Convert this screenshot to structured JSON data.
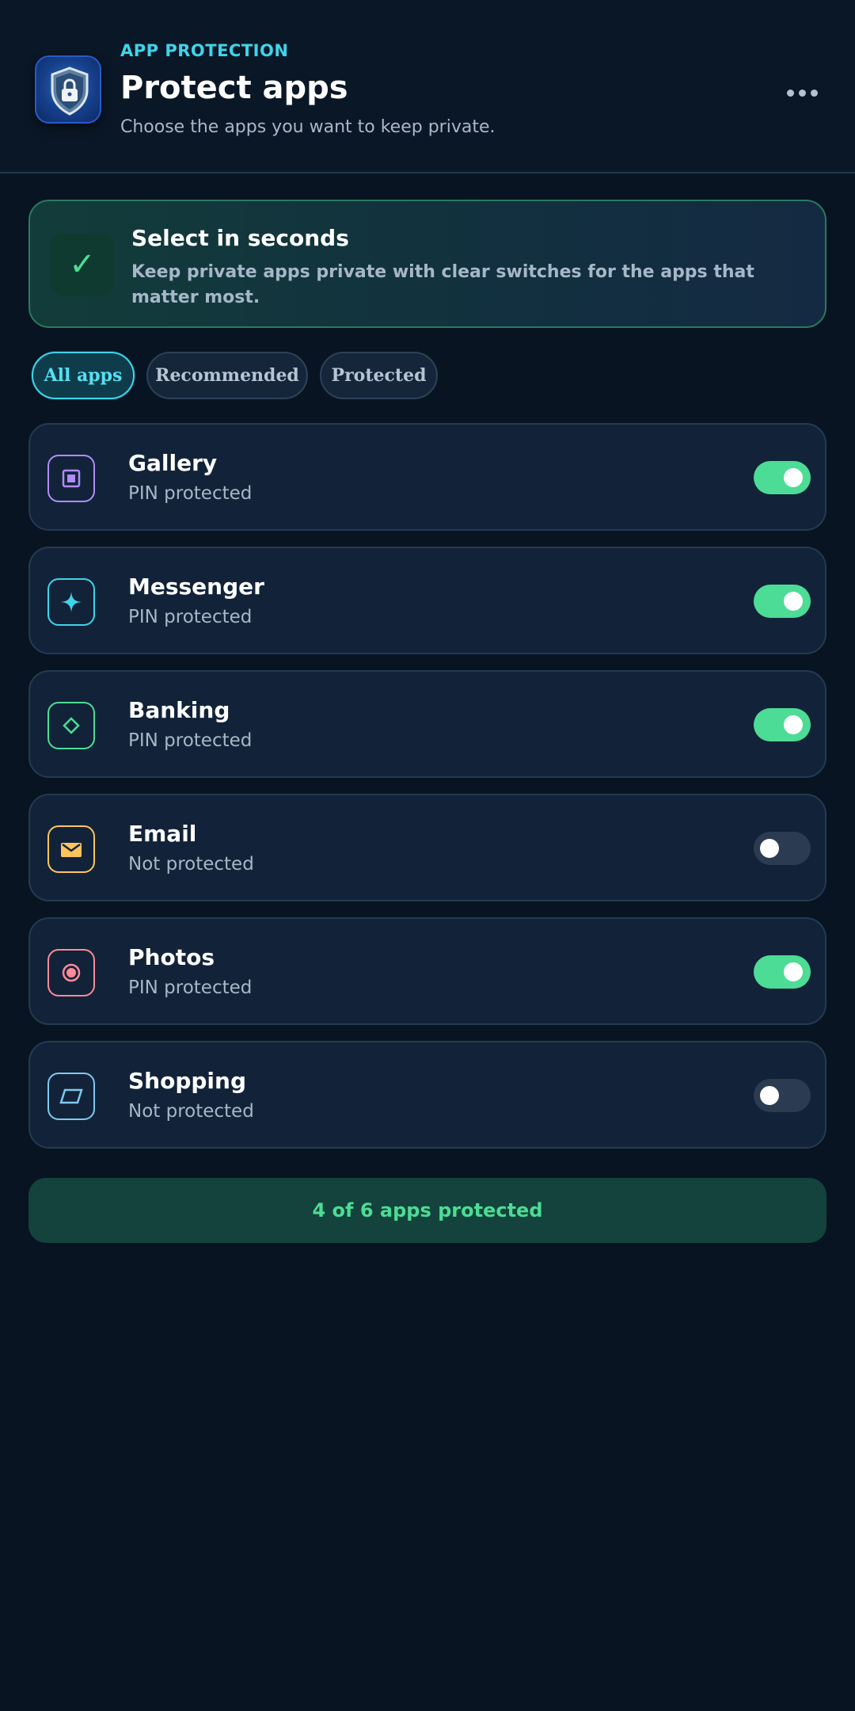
{
  "header": {
    "eyebrow": "APP PROTECTION",
    "title": "Protect apps",
    "subtitle": "Choose the apps you want to keep private.",
    "logo_icon": "shield-lock-icon",
    "more_icon": "more-horizontal-icon"
  },
  "banner": {
    "icon": "check-icon",
    "check_glyph": "✓",
    "title": "Select in seconds",
    "text": "Keep private apps private with clear switches for the apps that matter most."
  },
  "filters": [
    {
      "label": "All apps",
      "active": true
    },
    {
      "label": "Recommended",
      "active": false
    },
    {
      "label": "Protected",
      "active": false
    }
  ],
  "apps": [
    {
      "name": "Gallery",
      "status": "PIN protected",
      "protected": true,
      "icon": "gallery-icon",
      "color": "#b08cff"
    },
    {
      "name": "Messenger",
      "status": "PIN protected",
      "protected": true,
      "icon": "sparkle-icon",
      "color": "#3fd4ea"
    },
    {
      "name": "Banking",
      "status": "PIN protected",
      "protected": true,
      "icon": "diamond-icon",
      "color": "#4ddc95"
    },
    {
      "name": "Email",
      "status": "Not protected",
      "protected": false,
      "icon": "mail-icon",
      "color": "#ffc55c"
    },
    {
      "name": "Photos",
      "status": "PIN protected",
      "protected": true,
      "icon": "record-icon",
      "color": "#ff8a98"
    },
    {
      "name": "Shopping",
      "status": "Not protected",
      "protected": false,
      "icon": "tag-icon",
      "color": "#7fc8f0"
    }
  ],
  "summary": {
    "label": "4 of 6 apps protected"
  },
  "colors": {
    "accent": "#3fd4ea",
    "success": "#4ddc95",
    "background": "#081421",
    "card": "#122339"
  }
}
